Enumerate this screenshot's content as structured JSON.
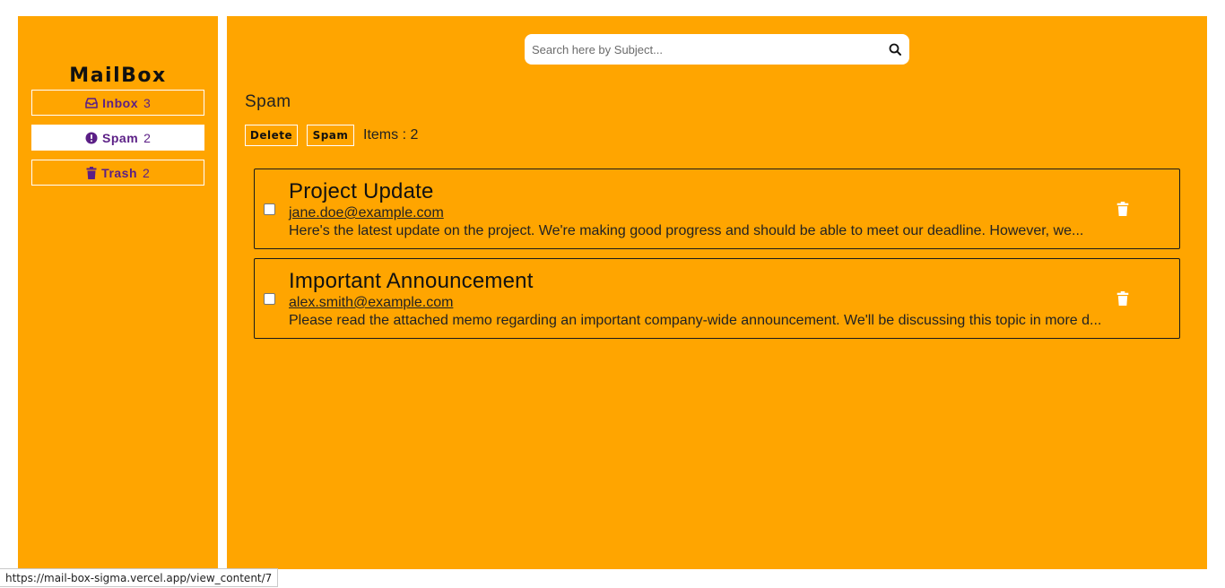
{
  "sidebar": {
    "app_title": "MailBox",
    "items": [
      {
        "label": "Inbox",
        "count": "3",
        "icon": "inbox-icon",
        "active": false
      },
      {
        "label": "Spam",
        "count": "2",
        "icon": "alert-circle-icon",
        "active": true
      },
      {
        "label": "Trash",
        "count": "2",
        "icon": "trash-icon",
        "active": false
      }
    ]
  },
  "search": {
    "placeholder": "Search here by Subject...",
    "value": "",
    "icon": "search-icon"
  },
  "main": {
    "title": "Spam",
    "toolbar": {
      "delete_label": "Delete",
      "spam_label": "Spam",
      "items_count": "Items : 2"
    },
    "mails": [
      {
        "subject": "Project Update",
        "from": "jane.doe@example.com",
        "preview": "Here's the latest update on the project. We're making good progress and should be able to meet our deadline. However, we..."
      },
      {
        "subject": "Important Announcement",
        "from": "alex.smith@example.com",
        "preview": "Please read the attached memo regarding an important company-wide announcement. We'll be discussing this topic in more d..."
      }
    ]
  },
  "status_bar": {
    "url": "https://mail-box-sigma.vercel.app/view_content/7"
  },
  "colors": {
    "accent": "#ffa500",
    "nav_text": "#5b1f86",
    "background": "#ffffff"
  }
}
